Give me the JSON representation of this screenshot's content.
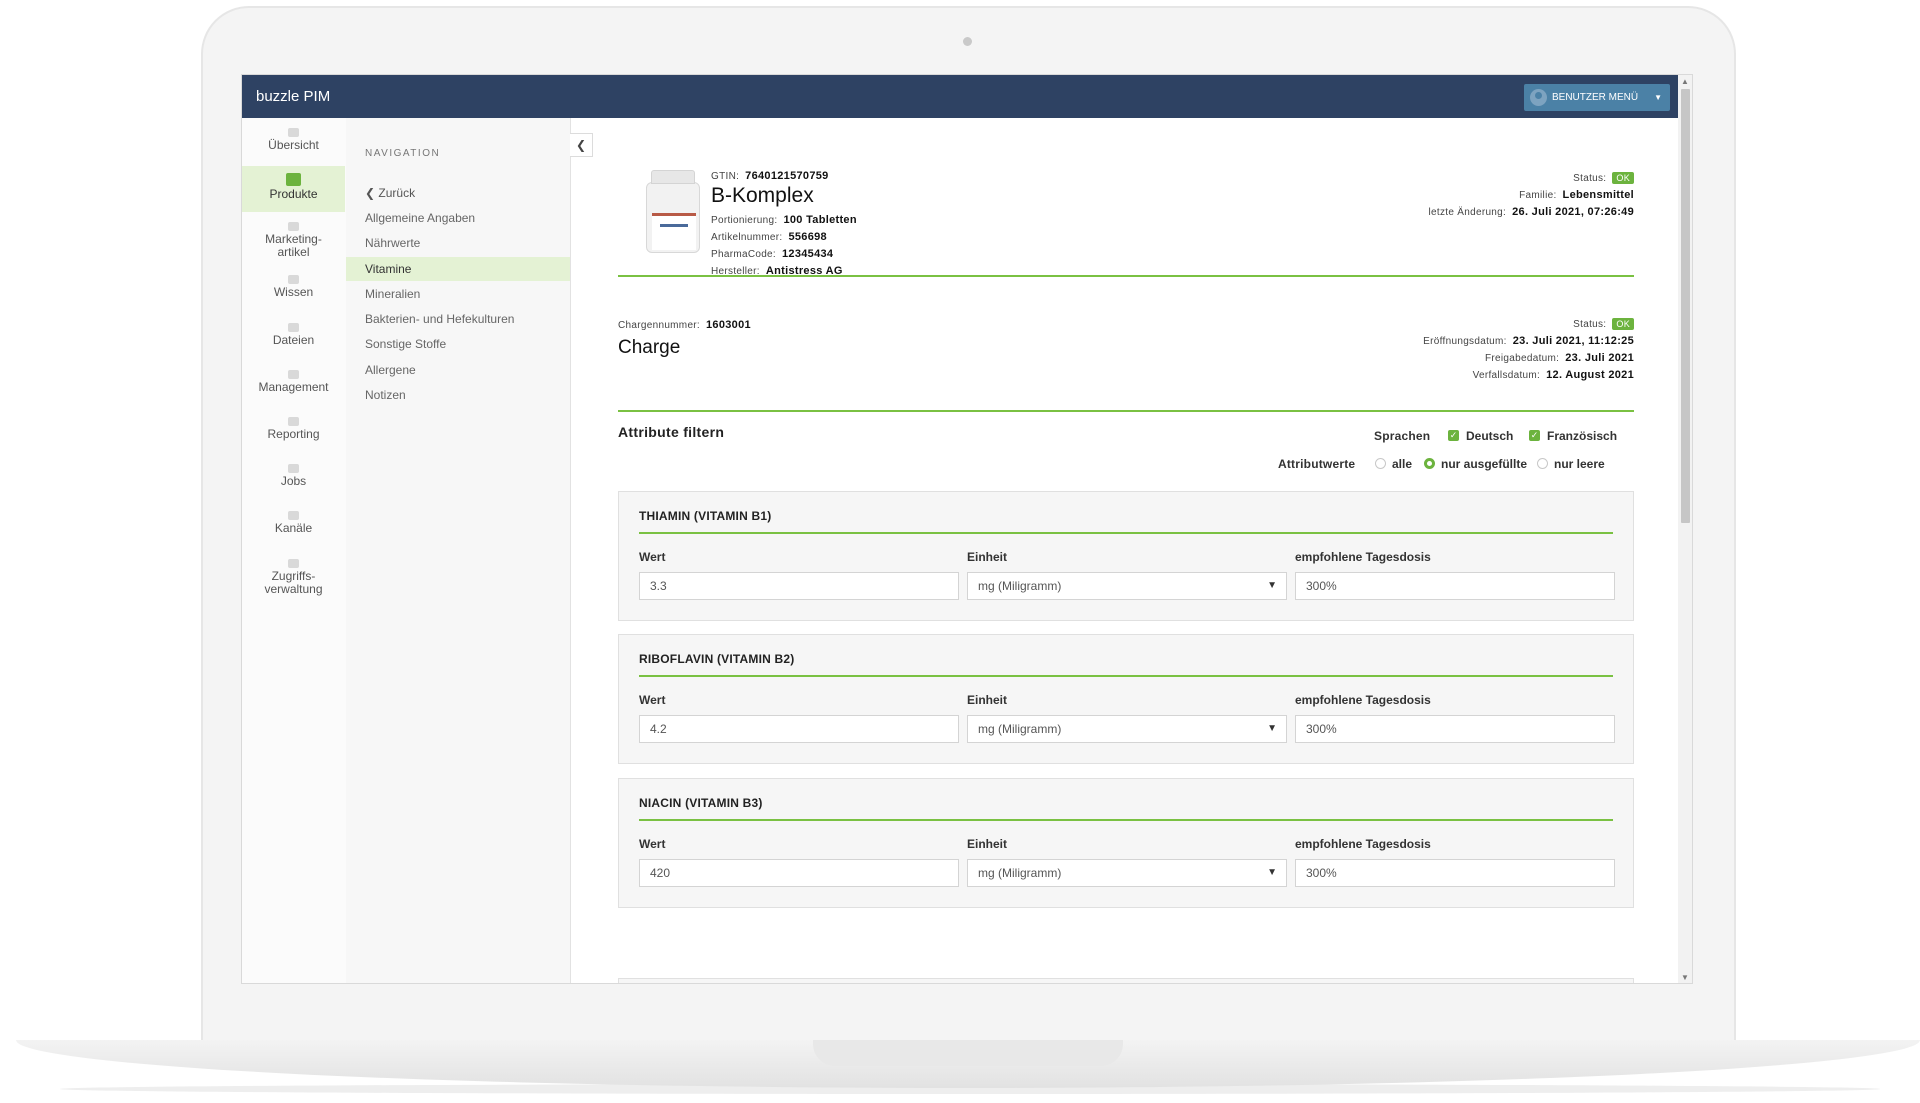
{
  "app": {
    "title": "buzzle PIM",
    "user_menu": "BENUTZER MENÜ"
  },
  "sidebar": {
    "items": [
      {
        "label": "Übersicht",
        "active": false
      },
      {
        "label": "Produkte",
        "active": true
      },
      {
        "label": "Marketing-\nartikel",
        "active": false
      },
      {
        "label": "Wissen",
        "active": false
      },
      {
        "label": "Dateien",
        "active": false
      },
      {
        "label": "Management",
        "active": false
      },
      {
        "label": "Reporting",
        "active": false
      },
      {
        "label": "Jobs",
        "active": false
      },
      {
        "label": "Kanäle",
        "active": false
      },
      {
        "label": "Zugriffs-\nverwaltung",
        "active": false
      }
    ]
  },
  "nav": {
    "heading": "NAVIGATION",
    "back": "Zurück",
    "links": [
      {
        "label": "Allgemeine Angaben",
        "active": false
      },
      {
        "label": "Nährwerte",
        "active": false
      },
      {
        "label": "Vitamine",
        "active": true
      },
      {
        "label": "Mineralien",
        "active": false
      },
      {
        "label": "Bakterien- und Hefekulturen",
        "active": false
      },
      {
        "label": "Sonstige Stoffe",
        "active": false
      },
      {
        "label": "Allergene",
        "active": false
      },
      {
        "label": "Notizen",
        "active": false
      }
    ]
  },
  "product": {
    "gtin_label": "GTIN:",
    "gtin": "7640121570759",
    "name": "B-Komplex",
    "portion_label": "Portionierung:",
    "portion": "100 Tabletten",
    "article_label": "Artikelnummer:",
    "article": "556698",
    "pharma_label": "PharmaCode:",
    "pharma": "12345434",
    "maker_label": "Hersteller:",
    "maker": "Antistress AG",
    "status_label": "Status:",
    "status": "OK",
    "family_label": "Familie:",
    "family": "Lebensmittel",
    "changed_label": "letzte Änderung:",
    "changed": "26. Juli 2021, 07:26:49"
  },
  "charge": {
    "number_label": "Chargennummer:",
    "number": "1603001",
    "title": "Charge",
    "status_label": "Status:",
    "status": "OK",
    "opened_label": "Eröffnungsdatum:",
    "opened": "23. Juli 2021, 11:12:25",
    "released_label": "Freigabedatum:",
    "released": "23. Juli 2021",
    "expiry_label": "Verfallsdatum:",
    "expiry": "12. August 2021"
  },
  "filter": {
    "title": "Attribute filtern",
    "languages_label": "Sprachen",
    "lang_de": "Deutsch",
    "lang_de_checked": true,
    "lang_fr": "Französisch",
    "lang_fr_checked": true,
    "values_label": "Attributwerte",
    "opt_all": "alle",
    "opt_filled": "nur ausgefüllte",
    "opt_empty": "nur leere",
    "selected": "nur ausgefüllte"
  },
  "cards": [
    {
      "title": "THIAMIN (VITAMIN B1)",
      "wert_label": "Wert",
      "wert": "3.3",
      "einheit_label": "Einheit",
      "einheit": "mg (Miligramm)",
      "dosis_label": "empfohlene Tagesdosis",
      "dosis": "300%"
    },
    {
      "title": "RIBOFLAVIN (VITAMIN B2)",
      "wert_label": "Wert",
      "wert": "4.2",
      "einheit_label": "Einheit",
      "einheit": "mg (Miligramm)",
      "dosis_label": "empfohlene Tagesdosis",
      "dosis": "300%"
    },
    {
      "title": "NIACIN (VITAMIN B3)",
      "wert_label": "Wert",
      "wert": "420",
      "einheit_label": "Einheit",
      "einheit": "mg (Miligramm)",
      "dosis_label": "empfohlene Tagesdosis",
      "dosis": "300%"
    }
  ],
  "colors": {
    "topbar": "#2e4263",
    "accent": "#6cb33e",
    "user_menu": "#4b81a6",
    "active_bg": "#e4f2d4"
  }
}
